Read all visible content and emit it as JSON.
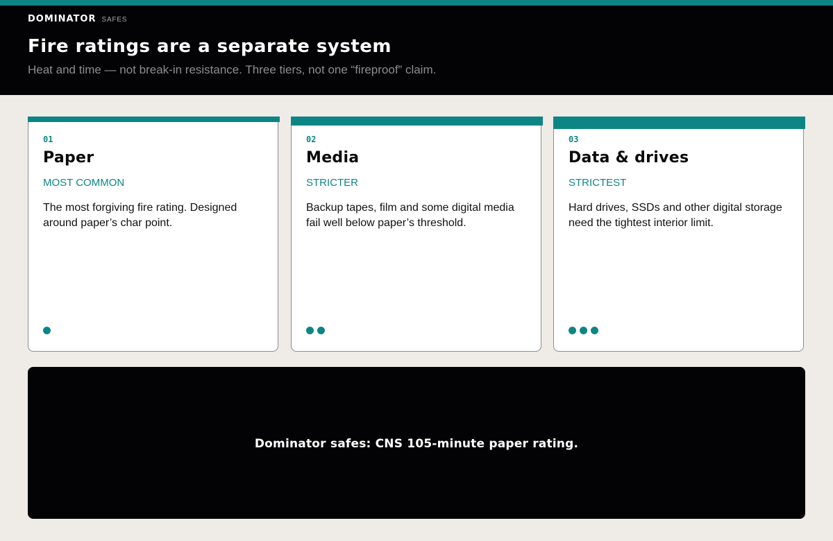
{
  "brand": {
    "name": "DOMINATOR",
    "sub": "SAFES"
  },
  "header": {
    "title": "Fire ratings are a separate system",
    "subtitle": "Heat and time — not break-in resistance. Three tiers, not one “fireproof” claim."
  },
  "colors": {
    "accent": "#0e8585",
    "header_bg": "#030305",
    "page_bg": "#efebe7"
  },
  "cards": [
    {
      "number": "01",
      "title": "Paper",
      "tag": "MOST COMMON",
      "description": "The most forgiving fire rating. Designed around paper’s char point.",
      "level": 1
    },
    {
      "number": "02",
      "title": "Media",
      "tag": "STRICTER",
      "description": "Backup tapes, film and some digital media fail well below paper’s threshold.",
      "level": 2
    },
    {
      "number": "03",
      "title": "Data & drives",
      "tag": "STRICTEST",
      "description": "Hard drives, SSDs and other digital storage need the tightest interior limit.",
      "level": 3
    }
  ],
  "footer": {
    "text": "Dominator safes: CNS 105-minute paper rating."
  }
}
